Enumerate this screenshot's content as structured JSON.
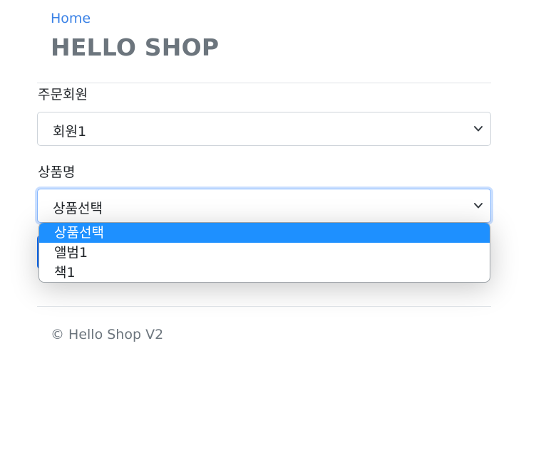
{
  "header": {
    "home_link": "Home",
    "title": "HELLO SHOP"
  },
  "form": {
    "member_label": "주문회원",
    "member_selected": "회원1",
    "item_label": "상품명",
    "item_selected": "상품선택",
    "item_options": [
      "상품선택",
      "앨범1",
      "책1"
    ]
  },
  "footer": {
    "copyright": "© Hello Shop V2"
  },
  "colors": {
    "link": "#3b82e6",
    "highlight": "#1e90ff",
    "muted_text": "#6c757d"
  },
  "icons": {
    "select_arrow": "chevron-down-icon"
  }
}
